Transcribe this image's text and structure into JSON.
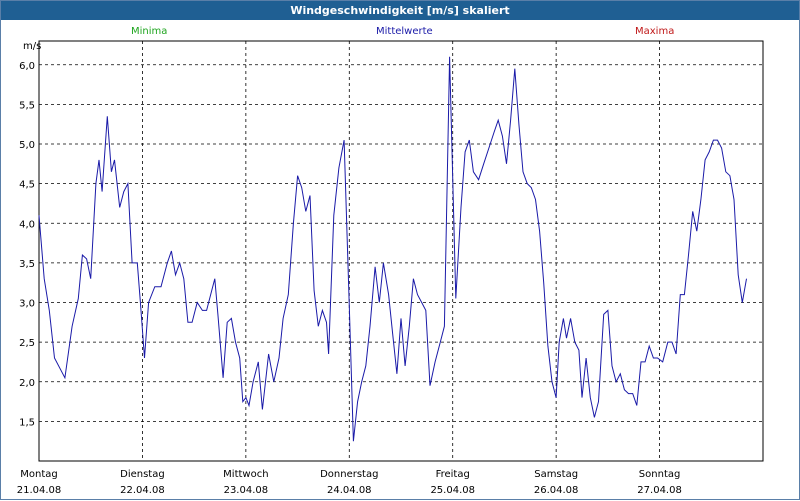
{
  "window": {
    "title": "Windgeschwindigkeit [m/s] skaliert"
  },
  "legend": {
    "min": "Minima",
    "avg": "Mittelwerte",
    "max": "Maxima"
  },
  "colors": {
    "series": "#1a1aa8",
    "min": "#1fa51f",
    "max": "#c01818",
    "titlebar": "#1f5f93"
  },
  "chart_data": {
    "type": "line",
    "title": "Windgeschwindigkeit [m/s] skaliert",
    "ylabel": "m/s",
    "ylim": [
      1.0,
      6.3
    ],
    "xlim": [
      0,
      7
    ],
    "grid": true,
    "legend_position": "top",
    "y_ticks": [
      "1,5",
      "2,0",
      "2,5",
      "3,0",
      "3,5",
      "4,0",
      "4,5",
      "5,0",
      "5,5",
      "6,0"
    ],
    "y_tick_values": [
      1.5,
      2.0,
      2.5,
      3.0,
      3.5,
      4.0,
      4.5,
      5.0,
      5.5,
      6.0
    ],
    "x_ticks": [
      {
        "day": "Montag",
        "date": "21.04.08"
      },
      {
        "day": "Dienstag",
        "date": "22.04.08"
      },
      {
        "day": "Mittwoch",
        "date": "23.04.08"
      },
      {
        "day": "Donnerstag",
        "date": "24.04.08"
      },
      {
        "day": "Freitag",
        "date": "25.04.08"
      },
      {
        "day": "Samstag",
        "date": "26.04.08"
      },
      {
        "day": "Sonntag",
        "date": "27.04.08"
      }
    ],
    "series": [
      {
        "name": "Mittelwerte",
        "values": [
          [
            0.0,
            4.1
          ],
          [
            0.05,
            3.3
          ],
          [
            0.1,
            2.9
          ],
          [
            0.15,
            2.3
          ],
          [
            0.25,
            2.05
          ],
          [
            0.32,
            2.7
          ],
          [
            0.38,
            3.05
          ],
          [
            0.42,
            3.6
          ],
          [
            0.46,
            3.55
          ],
          [
            0.5,
            3.3
          ],
          [
            0.55,
            4.5
          ],
          [
            0.58,
            4.8
          ],
          [
            0.61,
            4.4
          ],
          [
            0.66,
            5.35
          ],
          [
            0.7,
            4.65
          ],
          [
            0.73,
            4.8
          ],
          [
            0.78,
            4.2
          ],
          [
            0.82,
            4.4
          ],
          [
            0.86,
            4.5
          ],
          [
            0.9,
            3.5
          ],
          [
            0.95,
            3.5
          ],
          [
            0.98,
            3.0
          ],
          [
            1.02,
            2.3
          ],
          [
            1.06,
            3.0
          ],
          [
            1.12,
            3.2
          ],
          [
            1.18,
            3.2
          ],
          [
            1.24,
            3.5
          ],
          [
            1.28,
            3.65
          ],
          [
            1.32,
            3.35
          ],
          [
            1.36,
            3.5
          ],
          [
            1.4,
            3.3
          ],
          [
            1.44,
            2.75
          ],
          [
            1.48,
            2.75
          ],
          [
            1.53,
            3.0
          ],
          [
            1.58,
            2.9
          ],
          [
            1.62,
            2.9
          ],
          [
            1.67,
            3.15
          ],
          [
            1.7,
            3.3
          ],
          [
            1.73,
            2.85
          ],
          [
            1.78,
            2.05
          ],
          [
            1.82,
            2.75
          ],
          [
            1.86,
            2.8
          ],
          [
            1.9,
            2.5
          ],
          [
            1.94,
            2.3
          ],
          [
            1.97,
            1.75
          ],
          [
            2.0,
            1.8
          ],
          [
            2.03,
            1.7
          ],
          [
            2.07,
            2.0
          ],
          [
            2.12,
            2.25
          ],
          [
            2.16,
            1.65
          ],
          [
            2.22,
            2.35
          ],
          [
            2.27,
            2.0
          ],
          [
            2.32,
            2.3
          ],
          [
            2.36,
            2.8
          ],
          [
            2.41,
            3.1
          ],
          [
            2.46,
            4.0
          ],
          [
            2.5,
            4.6
          ],
          [
            2.54,
            4.45
          ],
          [
            2.58,
            4.15
          ],
          [
            2.62,
            4.35
          ],
          [
            2.66,
            3.15
          ],
          [
            2.7,
            2.7
          ],
          [
            2.74,
            2.9
          ],
          [
            2.78,
            2.75
          ],
          [
            2.8,
            2.35
          ],
          [
            2.85,
            4.1
          ],
          [
            2.9,
            4.7
          ],
          [
            2.95,
            5.05
          ],
          [
            3.0,
            2.95
          ],
          [
            3.04,
            1.25
          ],
          [
            3.08,
            1.75
          ],
          [
            3.12,
            2.0
          ],
          [
            3.16,
            2.2
          ],
          [
            3.2,
            2.7
          ],
          [
            3.25,
            3.45
          ],
          [
            3.29,
            3.0
          ],
          [
            3.33,
            3.5
          ],
          [
            3.38,
            3.1
          ],
          [
            3.42,
            2.6
          ],
          [
            3.46,
            2.1
          ],
          [
            3.5,
            2.8
          ],
          [
            3.54,
            2.2
          ],
          [
            3.58,
            2.7
          ],
          [
            3.62,
            3.3
          ],
          [
            3.66,
            3.1
          ],
          [
            3.7,
            3.0
          ],
          [
            3.74,
            2.9
          ],
          [
            3.78,
            1.95
          ],
          [
            3.83,
            2.25
          ],
          [
            3.88,
            2.5
          ],
          [
            3.92,
            2.7
          ],
          [
            3.97,
            6.1
          ],
          [
            4.03,
            3.05
          ],
          [
            4.08,
            4.2
          ],
          [
            4.12,
            4.9
          ],
          [
            4.16,
            5.05
          ],
          [
            4.2,
            4.65
          ],
          [
            4.25,
            4.55
          ],
          [
            4.3,
            4.75
          ],
          [
            4.35,
            4.95
          ],
          [
            4.4,
            5.15
          ],
          [
            4.44,
            5.3
          ],
          [
            4.48,
            5.1
          ],
          [
            4.52,
            4.75
          ],
          [
            4.56,
            5.3
          ],
          [
            4.6,
            5.95
          ],
          [
            4.64,
            5.25
          ],
          [
            4.68,
            4.65
          ],
          [
            4.72,
            4.5
          ],
          [
            4.76,
            4.45
          ],
          [
            4.8,
            4.3
          ],
          [
            4.84,
            3.9
          ],
          [
            4.88,
            3.25
          ],
          [
            4.92,
            2.45
          ],
          [
            4.96,
            2.0
          ],
          [
            5.0,
            1.8
          ],
          [
            5.03,
            2.5
          ],
          [
            5.07,
            2.8
          ],
          [
            5.1,
            2.55
          ],
          [
            5.14,
            2.8
          ],
          [
            5.18,
            2.5
          ],
          [
            5.22,
            2.4
          ],
          [
            5.25,
            1.8
          ],
          [
            5.29,
            2.3
          ],
          [
            5.33,
            1.8
          ],
          [
            5.37,
            1.55
          ],
          [
            5.41,
            1.75
          ],
          [
            5.46,
            2.85
          ],
          [
            5.5,
            2.9
          ],
          [
            5.54,
            2.2
          ],
          [
            5.58,
            2.0
          ],
          [
            5.62,
            2.1
          ],
          [
            5.66,
            1.9
          ],
          [
            5.7,
            1.85
          ],
          [
            5.74,
            1.85
          ],
          [
            5.78,
            1.7
          ],
          [
            5.82,
            2.25
          ],
          [
            5.86,
            2.25
          ],
          [
            5.9,
            2.45
          ],
          [
            5.94,
            2.3
          ],
          [
            5.98,
            2.3
          ],
          [
            6.03,
            2.25
          ],
          [
            6.08,
            2.5
          ],
          [
            6.12,
            2.5
          ],
          [
            6.16,
            2.35
          ],
          [
            6.2,
            3.1
          ],
          [
            6.24,
            3.1
          ],
          [
            6.28,
            3.6
          ],
          [
            6.32,
            4.15
          ],
          [
            6.36,
            3.9
          ],
          [
            6.4,
            4.3
          ],
          [
            6.44,
            4.8
          ],
          [
            6.48,
            4.9
          ],
          [
            6.52,
            5.05
          ],
          [
            6.56,
            5.05
          ],
          [
            6.6,
            4.95
          ],
          [
            6.64,
            4.65
          ],
          [
            6.68,
            4.6
          ],
          [
            6.72,
            4.3
          ],
          [
            6.76,
            3.35
          ],
          [
            6.8,
            3.0
          ],
          [
            6.84,
            3.3
          ]
        ]
      }
    ]
  }
}
